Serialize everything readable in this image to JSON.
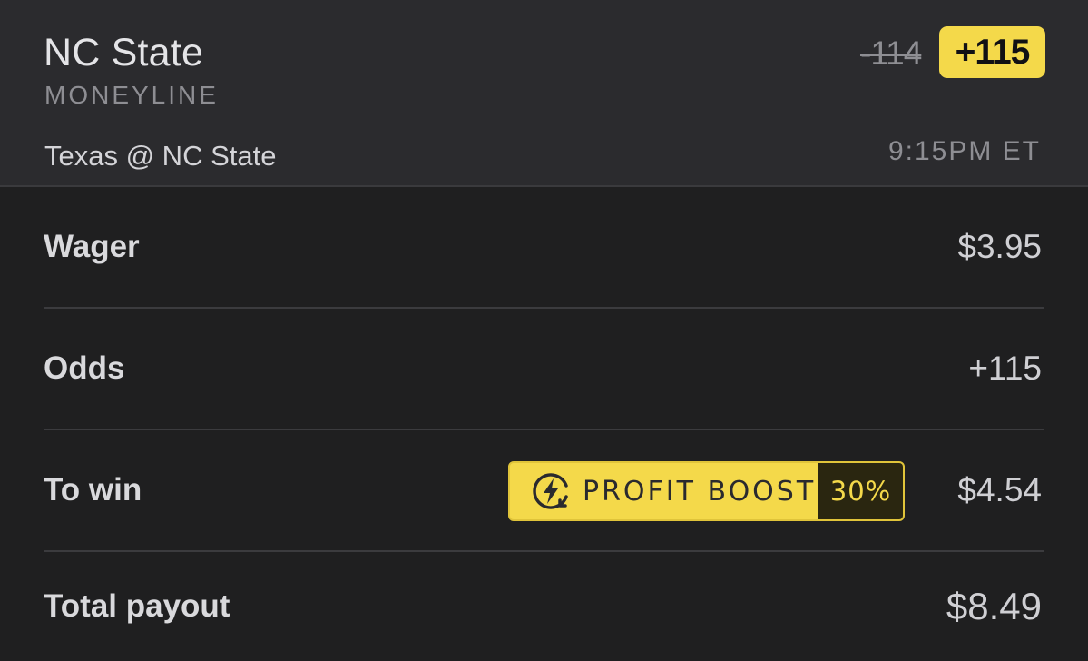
{
  "bet": {
    "selection": "NC State",
    "market": "MONEYLINE",
    "matchup": "Texas @ NC State",
    "game_time": "9:15PM ET",
    "original_odds": "-114",
    "boosted_odds": "+115"
  },
  "rows": {
    "wager": {
      "label": "Wager",
      "value": "$3.95"
    },
    "odds": {
      "label": "Odds",
      "value": "+115"
    },
    "to_win": {
      "label": "To win",
      "value": "$4.54"
    },
    "total_payout": {
      "label": "Total payout",
      "value": "$8.49"
    }
  },
  "profit_boost": {
    "label": "PROFIT BOOST",
    "percent": "30%",
    "icon": "lightning-boost-icon"
  },
  "colors": {
    "accent_yellow": "#f4d94a",
    "background": "#1f1f20",
    "header_background": "#2b2b2e"
  }
}
